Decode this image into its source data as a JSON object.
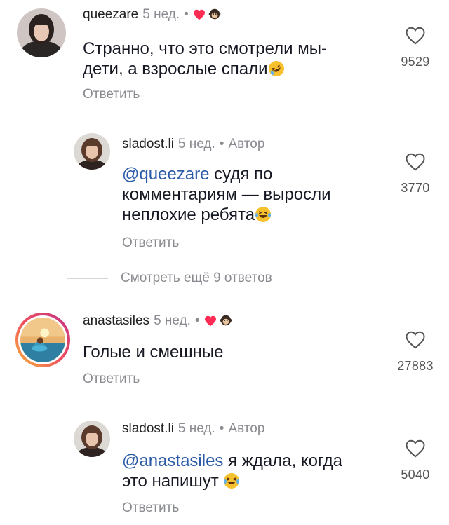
{
  "comments": [
    {
      "username": "queezare",
      "time": "5 нед.",
      "dot": "•",
      "text": "Странно, что это смотрели мы-дети, а взрослые спали",
      "text_line1": "Странно, что это смотрели мы-",
      "text_line2": "дети, а взрослые спали",
      "reply_label": "Ответить",
      "likes": "9529",
      "author_liked": true
    },
    {
      "username": "sladost.li",
      "time": "5 нед.",
      "dot": "•",
      "badge": "Автор",
      "mention": "@queezare",
      "text_line1": " судя по",
      "text_line2": "комментариям — выросли",
      "text_line3": "неплохие ребята",
      "reply_label": "Ответить",
      "likes": "3770"
    },
    {
      "username": "anastasiles",
      "time": "5 нед.",
      "dot": "•",
      "text": "Голые и смешные",
      "reply_label": "Ответить",
      "likes": "27883",
      "author_liked": true
    },
    {
      "username": "sladost.li",
      "time": "5 нед.",
      "dot": "•",
      "badge": "Автор",
      "mention": "@anastasiles",
      "text_line1": " я ждала, когда",
      "text_line2": "это напишут",
      "reply_label": "Ответить",
      "likes": "5040"
    }
  ],
  "view_more": "Смотреть ещё 9 ответов",
  "colors": {
    "mention": "#2b5aa8",
    "heart": "#fe2c55",
    "meta": "#8a8b91",
    "story_ring": "#e1306c"
  },
  "icons": [
    "heart-outline-icon",
    "heart-filled-icon",
    "monkey-emoji-icon",
    "rofl-emoji-icon",
    "laughing-tears-emoji-icon"
  ]
}
